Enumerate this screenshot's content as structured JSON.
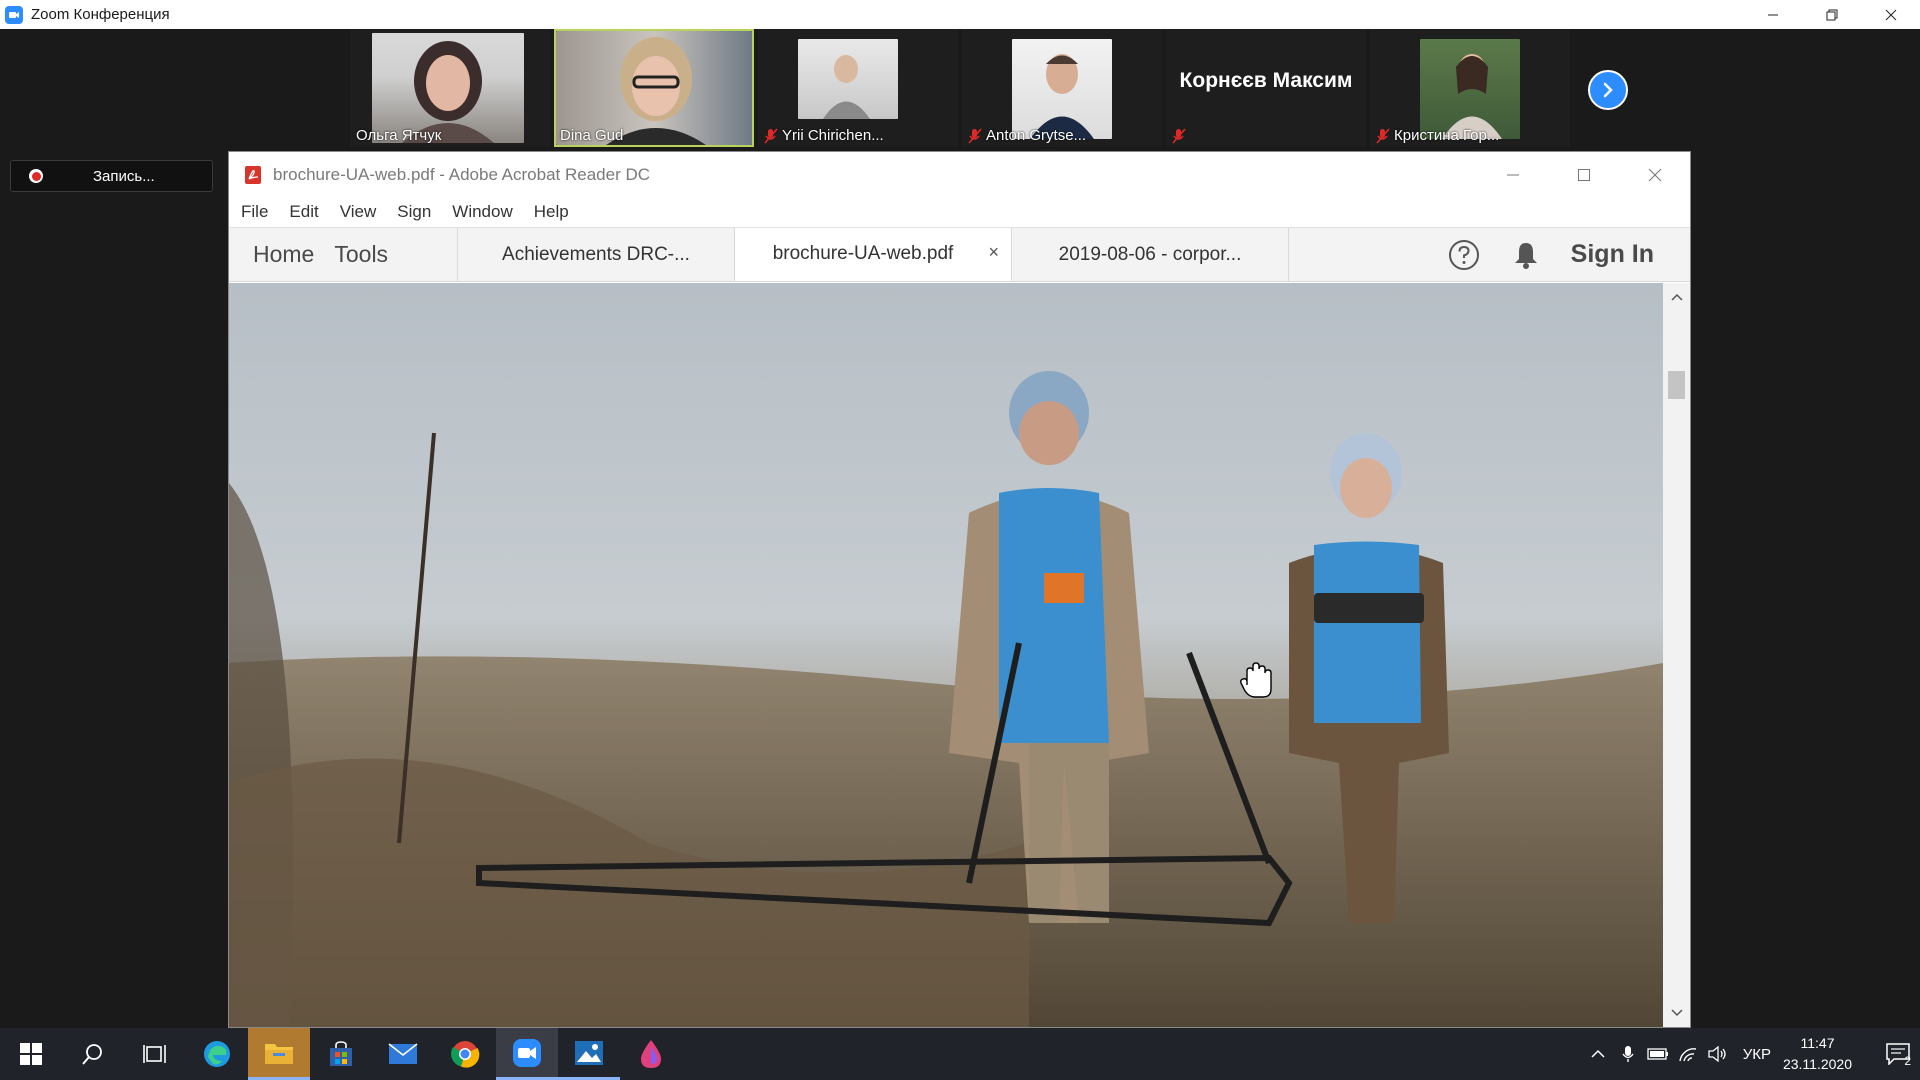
{
  "zoom": {
    "window_title": "Zoom Конференция",
    "recording_label": "Запись...",
    "participants": [
      {
        "name": "Ольга Ятчук",
        "muted": false
      },
      {
        "name": "Dina Gud",
        "muted": false
      },
      {
        "name": "Yrii Chirichen...",
        "muted": true
      },
      {
        "name": "Anton Grytse...",
        "muted": true
      },
      {
        "name": "Корнєєв Максим",
        "muted": true,
        "video": false
      },
      {
        "name": "Кристина Гор...",
        "muted": true
      }
    ]
  },
  "acrobat": {
    "window_title": "brochure-UA-web.pdf - Adobe Acrobat Reader DC",
    "menu": [
      "File",
      "Edit",
      "View",
      "Sign",
      "Window",
      "Help"
    ],
    "nav": {
      "home": "Home",
      "tools": "Tools"
    },
    "tabs": [
      {
        "label": "Achievements DRC-...",
        "active": false
      },
      {
        "label": "brochure-UA-web.pdf",
        "active": true
      },
      {
        "label": "2019-08-06 - corpor...",
        "active": false
      }
    ],
    "tab_close_symbol": "×",
    "sign_in": "Sign In"
  },
  "taskbar": {
    "apps": [
      "windows-start",
      "search",
      "task-view",
      "edge",
      "file-explorer",
      "store",
      "mail",
      "chrome",
      "zoom",
      "photos",
      "paint"
    ],
    "language": "УКР",
    "time": "11:47",
    "date": "23.11.2020",
    "notification_count": "2"
  },
  "colors": {
    "zoom_blue": "#2d8cff",
    "zoom_dark": "#1a1a1a",
    "taskbar": "#20232a",
    "mute_red": "#e02828",
    "active_speaker": "#b7d35c"
  }
}
